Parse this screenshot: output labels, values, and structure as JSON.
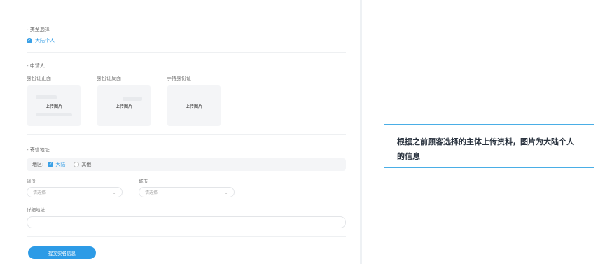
{
  "type_section": {
    "title": "- 类型选择",
    "selected_option": "大陆个人"
  },
  "applicant_section": {
    "title": "- 申请人",
    "uploads": [
      {
        "label": "身份证正面",
        "button": "上传图片"
      },
      {
        "label": "身份证反面",
        "button": "上传图片"
      },
      {
        "label": "手持身份证",
        "button": "上传图片"
      }
    ]
  },
  "address_section": {
    "title": "- 寄信地址",
    "region_label": "地区:",
    "region_options": [
      "大陆",
      "其他"
    ],
    "province_label": "省份",
    "province_placeholder": "请选择",
    "city_label": "城市",
    "city_placeholder": "请选择",
    "detail_label": "详细地址"
  },
  "submit_label": "提交实名信息",
  "callout": {
    "text": "根据之前顾客选择的主体上传资料，图片为大陆个人的信息"
  },
  "colors": {
    "accent": "#3aa0e6",
    "callout_border": "#4aaee6"
  }
}
